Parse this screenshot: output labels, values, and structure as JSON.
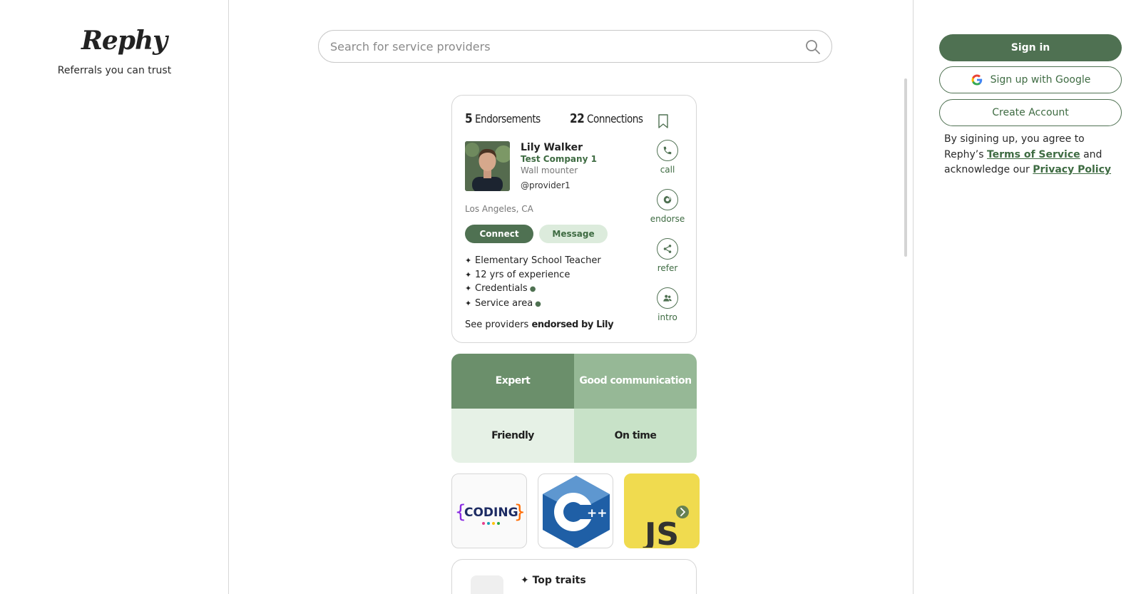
{
  "brand": {
    "name": "Rephy",
    "tagline": "Referrals you can trust"
  },
  "search": {
    "placeholder": "Search for service providers"
  },
  "profile": {
    "endorsements_count": "5",
    "endorsements_label": "Endorsements",
    "connections_count": "22",
    "connections_label": "Connections",
    "name": "Lily Walker",
    "company": "Test Company 1",
    "role": "Wall mounter",
    "handle": "@provider1",
    "location": "Los Angeles, CA",
    "connect_label": "Connect",
    "message_label": "Message",
    "bullets": [
      "Elementary School Teacher",
      "12 yrs of experience",
      "Credentials",
      "Service area"
    ],
    "see_providers_prefix": "See providers",
    "see_providers_bold": "endorsed by Lily",
    "actions": [
      {
        "label": "call",
        "icon": "phone-icon"
      },
      {
        "label": "endorse",
        "icon": "endorse-icon"
      },
      {
        "label": "refer",
        "icon": "share-icon"
      },
      {
        "label": "intro",
        "icon": "people-icon"
      }
    ]
  },
  "traits": [
    {
      "label": "Expert",
      "bg": "#6b8f6b",
      "fg": "#ffffff"
    },
    {
      "label": "Good communication",
      "bg": "#96b896",
      "fg": "#ffffff"
    },
    {
      "label": "Friendly",
      "bg": "#e6f1e6",
      "fg": "#1f1f1f"
    },
    {
      "label": "On time",
      "bg": "#c8e2c8",
      "fg": "#1f1f1f"
    }
  ],
  "thumbnails": {
    "coding_text": "CODING",
    "cpp_text": "++",
    "js_text": "JS"
  },
  "second_card": {
    "title": "Top traits"
  },
  "auth": {
    "signin_label": "Sign in",
    "google_label": "Sign up with Google",
    "create_label": "Create Account",
    "legal_prefix": "By sigining up, you agree to Rephy’s",
    "terms_label": "Terms of Service",
    "legal_middle": "and acknowledge our",
    "privacy_label": "Privacy Policy"
  },
  "colors": {
    "accent": "#4f7152",
    "accent_text": "#3e6b42",
    "js_yellow": "#f0db4f",
    "cpp_blue": "#1f5fa6"
  }
}
